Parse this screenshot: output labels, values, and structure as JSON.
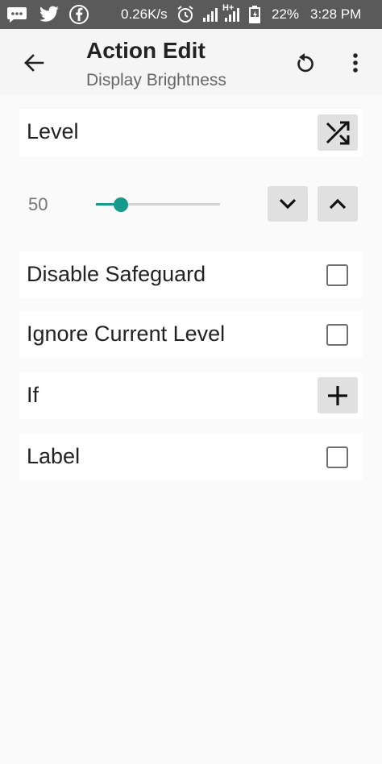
{
  "status_bar": {
    "speed": "0.26K/s",
    "network": "H+",
    "battery": "22%",
    "time": "3:28 PM",
    "icons": [
      "chat-icon",
      "twitter-icon",
      "facebook-icon",
      "alarm-icon",
      "signal-icon",
      "battery-icon"
    ]
  },
  "app_bar": {
    "title": "Action Edit",
    "subtitle": "Display Brightness",
    "icons": [
      "arrow-back-icon",
      "refresh-icon",
      "more-vert-icon"
    ]
  },
  "level": {
    "label": "Level",
    "value": "50",
    "slider_fraction": 0.2,
    "icons": [
      "shuffle-icon",
      "chevron-down-icon",
      "chevron-up-icon"
    ]
  },
  "options": {
    "disable_safeguard": {
      "label": "Disable Safeguard",
      "checked": false
    },
    "ignore_current_level": {
      "label": "Ignore Current Level",
      "checked": false
    },
    "if_label": "If",
    "label": {
      "label": "Label",
      "checked": false
    }
  },
  "colors": {
    "accent": "#159a8c",
    "status_bar": "#5a5a5a",
    "app_bar": "#f5f5f5",
    "background": "#fafafa",
    "card": "#ffffff",
    "button": "#e0e0e0"
  }
}
